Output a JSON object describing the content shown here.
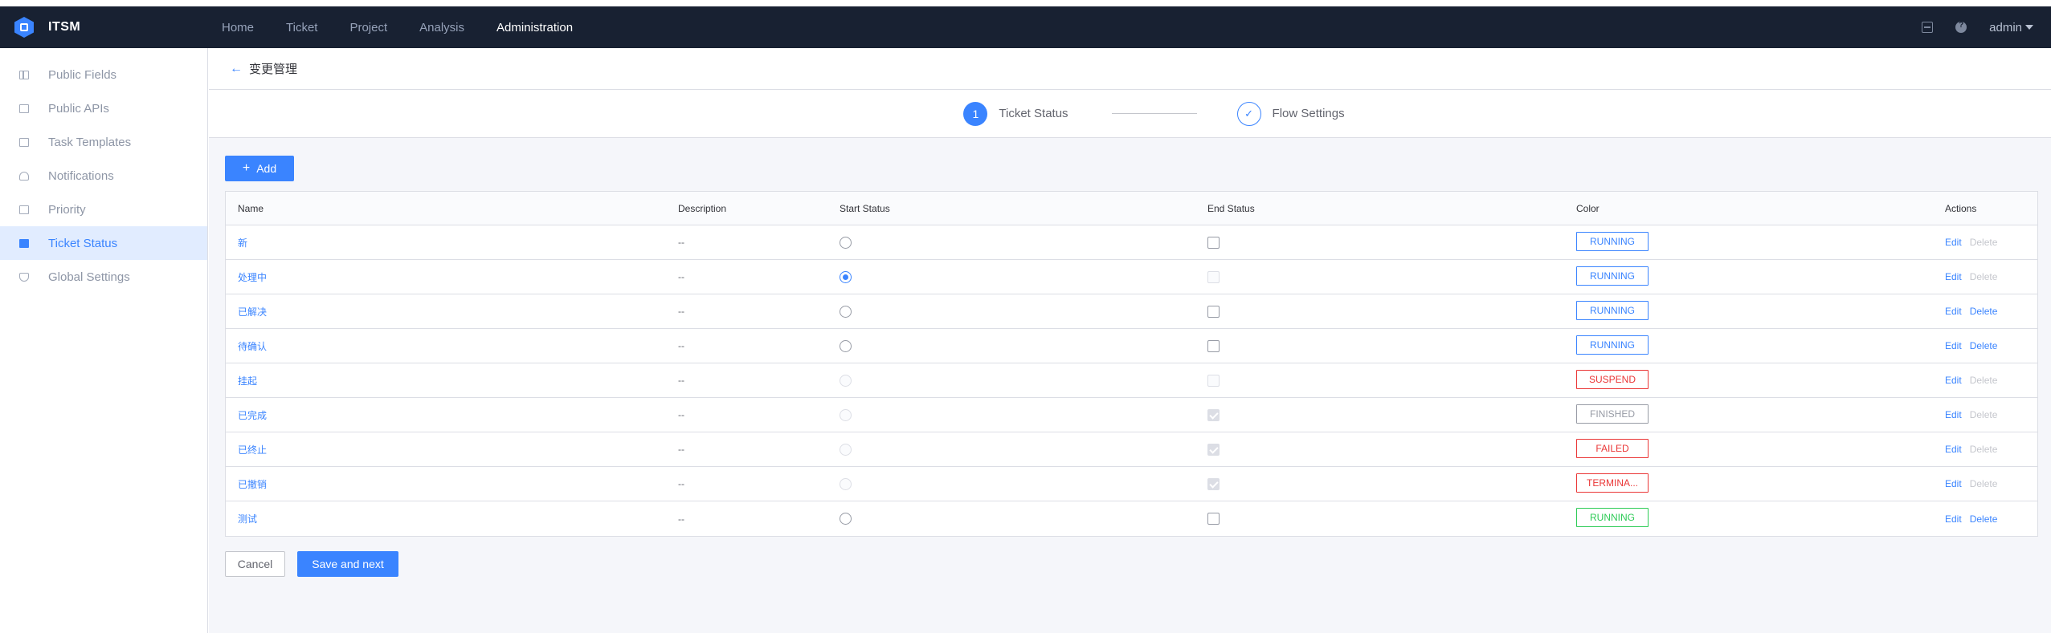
{
  "app": {
    "title": "ITSM"
  },
  "topnav": {
    "items": [
      {
        "label": "Home",
        "active": false
      },
      {
        "label": "Ticket",
        "active": false
      },
      {
        "label": "Project",
        "active": false
      },
      {
        "label": "Analysis",
        "active": false
      },
      {
        "label": "Administration",
        "active": true
      }
    ],
    "user": "admin"
  },
  "sidebar": {
    "items": [
      {
        "label": "Public Fields",
        "icon": "grid-icon",
        "active": false
      },
      {
        "label": "Public APIs",
        "icon": "api-icon",
        "active": false
      },
      {
        "label": "Task Templates",
        "icon": "template-icon",
        "active": false
      },
      {
        "label": "Notifications",
        "icon": "bell-icon",
        "active": false
      },
      {
        "label": "Priority",
        "icon": "priority-icon",
        "active": false
      },
      {
        "label": "Ticket Status",
        "icon": "status-icon",
        "active": true
      },
      {
        "label": "Global Settings",
        "icon": "shield-icon",
        "active": false
      }
    ]
  },
  "page": {
    "back_icon": "←",
    "title": "变更管理"
  },
  "steps": [
    {
      "number": "1",
      "label": "Ticket Status",
      "state": "current"
    },
    {
      "number": "✓",
      "label": "Flow Settings",
      "state": "done"
    }
  ],
  "toolbar": {
    "add_label": "Add",
    "add_icon": "+"
  },
  "table": {
    "columns": [
      "Name",
      "Description",
      "Start Status",
      "End Status",
      "Color",
      "Actions"
    ],
    "edit_label": "Edit",
    "delete_label": "Delete",
    "rows": [
      {
        "name": "新",
        "description": "--",
        "start": "unchecked",
        "end": "unchecked",
        "color_label": "RUNNING",
        "color": "#3a84ff",
        "edit": true,
        "delete": false
      },
      {
        "name": "处理中",
        "description": "--",
        "start": "checked",
        "end": "disabled",
        "color_label": "RUNNING",
        "color": "#3a84ff",
        "edit": true,
        "delete": false
      },
      {
        "name": "已解决",
        "description": "--",
        "start": "unchecked",
        "end": "unchecked",
        "color_label": "RUNNING",
        "color": "#3a84ff",
        "edit": true,
        "delete": true
      },
      {
        "name": "待确认",
        "description": "--",
        "start": "unchecked",
        "end": "unchecked",
        "color_label": "RUNNING",
        "color": "#3a84ff",
        "edit": true,
        "delete": true
      },
      {
        "name": "挂起",
        "description": "--",
        "start": "disabled",
        "end": "disabled",
        "color_label": "SUSPEND",
        "color": "#ea3636",
        "edit": true,
        "delete": false
      },
      {
        "name": "已完成",
        "description": "--",
        "start": "disabled",
        "end": "checked-disabled",
        "color_label": "FINISHED",
        "color": "#979ba5",
        "edit": true,
        "delete": false
      },
      {
        "name": "已终止",
        "description": "--",
        "start": "disabled",
        "end": "checked-disabled",
        "color_label": "FAILED",
        "color": "#ea3636",
        "edit": true,
        "delete": false
      },
      {
        "name": "已撤销",
        "description": "--",
        "start": "disabled",
        "end": "checked-disabled",
        "color_label": "TERMINA...",
        "color": "#ea3636",
        "edit": true,
        "delete": false
      },
      {
        "name": "测试",
        "description": "--",
        "start": "unchecked",
        "end": "unchecked",
        "color_label": "RUNNING",
        "color": "#2dcb56",
        "edit": true,
        "delete": true
      }
    ]
  },
  "footer": {
    "cancel_label": "Cancel",
    "save_label": "Save and next"
  }
}
